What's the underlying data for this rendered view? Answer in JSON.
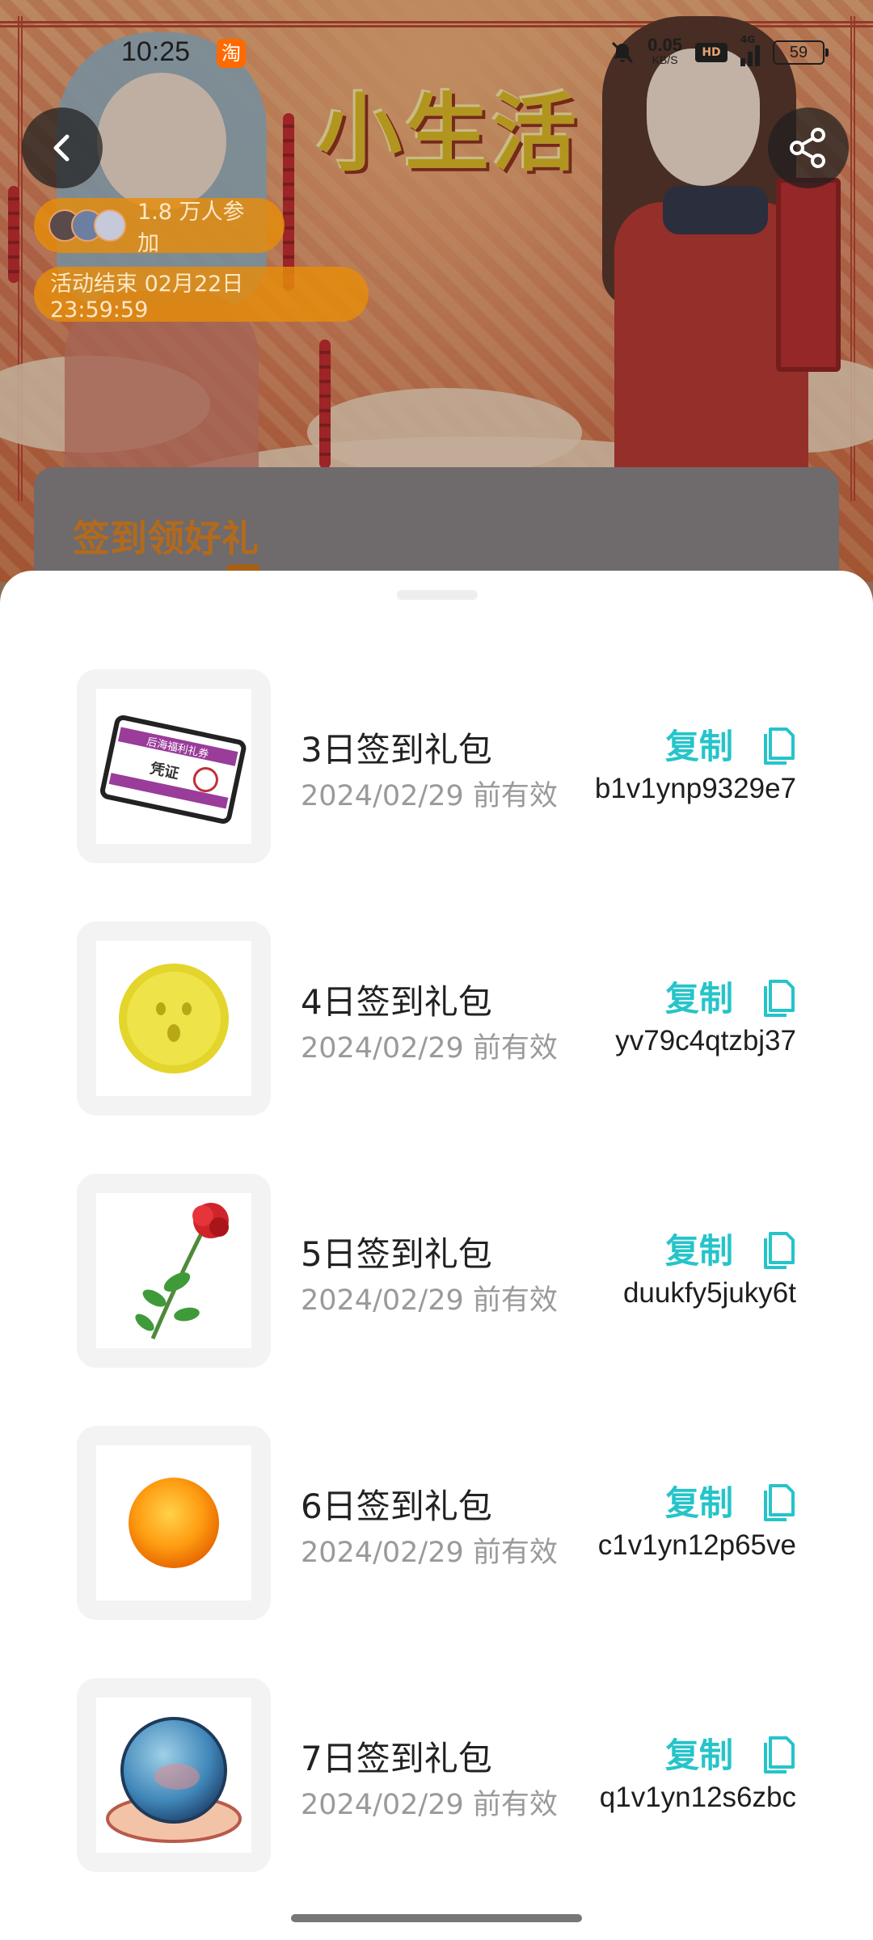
{
  "status_bar": {
    "time": "10:25",
    "app_badge": "淘",
    "net_speed_value": "0.05",
    "net_speed_unit": "KB/S",
    "hd_label": "HD",
    "signal_label": "4G",
    "battery": "59"
  },
  "header": {
    "title": "小生活",
    "participants": "1.8 万人参加",
    "end_time": "活动结束 02月22日 23:59:59"
  },
  "card": {
    "title": "签到领好礼"
  },
  "gifts": [
    {
      "name": "3日签到礼包",
      "expiry": "2024/02/29 前有效",
      "copy_label": "复制",
      "code": "b1v1ynp9329e7",
      "image": "welfare-coupon"
    },
    {
      "name": "4日签到礼包",
      "expiry": "2024/02/29 前有效",
      "copy_label": "复制",
      "code": "yv79c4qtzbj37",
      "image": "gold-coin"
    },
    {
      "name": "5日签到礼包",
      "expiry": "2024/02/29 前有效",
      "copy_label": "复制",
      "code": "duukfy5juky6t",
      "image": "red-rose"
    },
    {
      "name": "6日签到礼包",
      "expiry": "2024/02/29 前有效",
      "copy_label": "复制",
      "code": "c1v1yn12p65ve",
      "image": "orange-orb"
    },
    {
      "name": "7日签到礼包",
      "expiry": "2024/02/29 前有效",
      "copy_label": "复制",
      "code": "q1v1yn12s6zbc",
      "image": "crystal-ball"
    }
  ],
  "coupon_text": {
    "top": "后海福利礼券",
    "main": "凭证"
  },
  "colors": {
    "accent": "#25c4c9",
    "pill": "#e68c0a",
    "card_title": "#b36a1c"
  }
}
